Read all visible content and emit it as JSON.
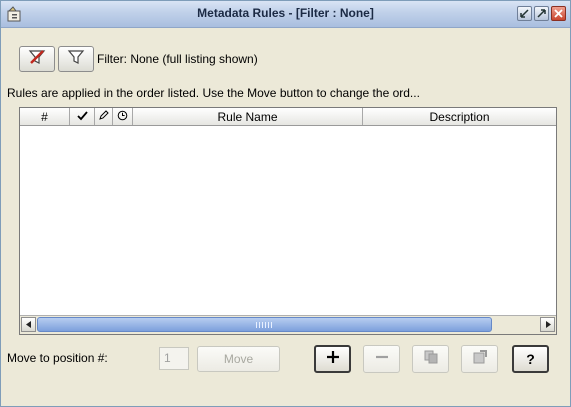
{
  "window": {
    "title": "Metadata Rules - [Filter : None]",
    "icons": [
      "app-icon",
      "restore-icon",
      "maximize-icon",
      "close-icon"
    ]
  },
  "toolbar": {
    "clear_filter_icon": "clear-filter-icon",
    "filter_icon": "filter-icon",
    "filter_status": "Filter: None (full listing shown)"
  },
  "info": {
    "text": "Rules are applied in the order listed. Use the Move button to change the ord..."
  },
  "table": {
    "columns": [
      "#",
      "",
      "",
      "",
      "Rule Name",
      "Description"
    ],
    "column_icons": [
      "checkmark-icon",
      "pencil-icon",
      "clock-icon"
    ],
    "rows": []
  },
  "footer": {
    "move_label": "Move to position #:",
    "position_value": "1",
    "move_button": "Move",
    "actions": [
      {
        "name": "add",
        "icon": "plus-icon",
        "enabled": true
      },
      {
        "name": "remove",
        "icon": "minus-icon",
        "enabled": false
      },
      {
        "name": "copy",
        "icon": "copy-icon",
        "enabled": false
      },
      {
        "name": "properties",
        "icon": "properties-icon",
        "enabled": false
      },
      {
        "name": "help",
        "icon": "help-icon",
        "enabled": true,
        "label": "?"
      }
    ]
  },
  "colors": {
    "title_gradient": "#c2d2ea",
    "scroll_thumb": "#7da0dc",
    "panel_bg": "#ece9d8"
  }
}
